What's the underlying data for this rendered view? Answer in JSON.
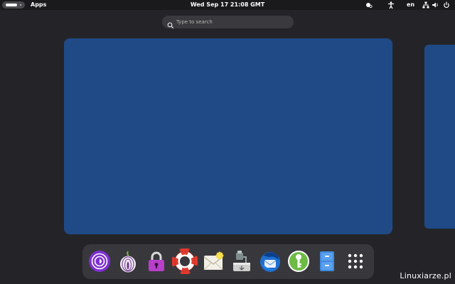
{
  "topbar": {
    "apps_label": "Apps",
    "clock": "Wed Sep 17  21:08 GMT",
    "language": "en"
  },
  "search": {
    "placeholder": "Type to search"
  },
  "dock": {
    "items": [
      {
        "icon": "tor-browser-icon"
      },
      {
        "icon": "onion-icon"
      },
      {
        "icon": "padlock-icon"
      },
      {
        "icon": "lifebuoy-icon"
      },
      {
        "icon": "mail-envelope-icon"
      },
      {
        "icon": "usb-installer-icon"
      },
      {
        "icon": "thunderbird-icon"
      },
      {
        "icon": "keepassxc-icon"
      },
      {
        "icon": "file-cabinet-icon"
      },
      {
        "icon": "app-grid-icon"
      }
    ]
  },
  "watermark": "Linuxiarze.pl",
  "colors": {
    "background": "#242428",
    "topbar": "#1a1a1d",
    "workspace": "#1f4a86",
    "dock": "#38383c"
  }
}
